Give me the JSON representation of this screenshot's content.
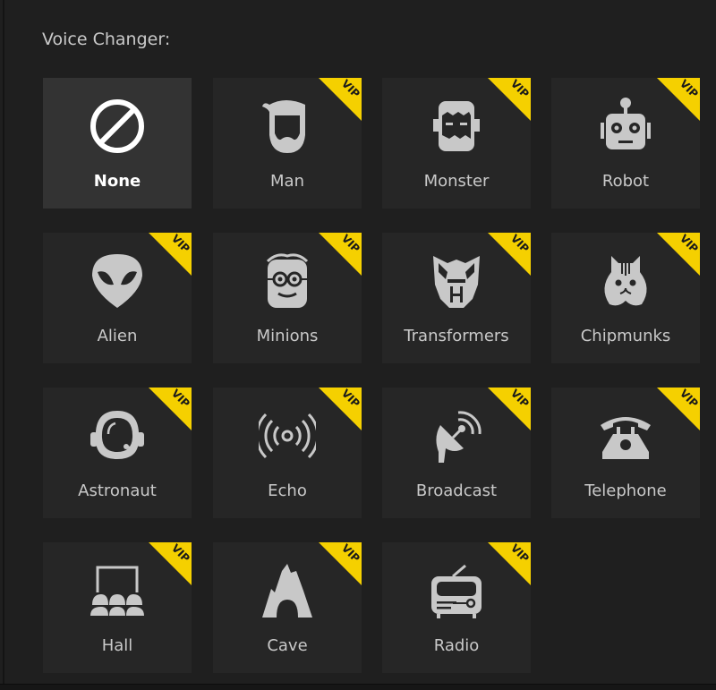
{
  "panel": {
    "title": "Voice Changer:",
    "accent_color": "#f5d000",
    "selected": "None",
    "badge_label": "VIP"
  },
  "voices": [
    {
      "label": "None",
      "icon": "none-icon",
      "vip": false,
      "selected": true
    },
    {
      "label": "Man",
      "icon": "man-icon",
      "vip": true
    },
    {
      "label": "Monster",
      "icon": "monster-icon",
      "vip": true
    },
    {
      "label": "Robot",
      "icon": "robot-icon",
      "vip": true
    },
    {
      "label": "Alien",
      "icon": "alien-icon",
      "vip": true
    },
    {
      "label": "Minions",
      "icon": "minion-icon",
      "vip": true
    },
    {
      "label": "Transformers",
      "icon": "transformers-icon",
      "vip": true
    },
    {
      "label": "Chipmunks",
      "icon": "chipmunk-icon",
      "vip": true
    },
    {
      "label": "Astronaut",
      "icon": "astronaut-icon",
      "vip": true
    },
    {
      "label": "Echo",
      "icon": "echo-icon",
      "vip": true
    },
    {
      "label": "Broadcast",
      "icon": "broadcast-icon",
      "vip": true
    },
    {
      "label": "Telephone",
      "icon": "telephone-icon",
      "vip": true
    },
    {
      "label": "Hall",
      "icon": "hall-icon",
      "vip": true
    },
    {
      "label": "Cave",
      "icon": "cave-icon",
      "vip": true
    },
    {
      "label": "Radio",
      "icon": "radio-icon",
      "vip": true
    }
  ]
}
